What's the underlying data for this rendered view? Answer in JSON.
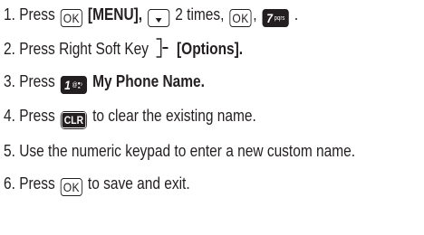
{
  "steps": [
    {
      "num": "1.",
      "press": "Press",
      "ok_key_label": "OK",
      "menu_label": "[MENU],",
      "times_text": "2 times,",
      "ok_key_label_2": "OK",
      "comma": ",",
      "key7_digit": "7",
      "key7_letters": "pqrs",
      "period": "."
    },
    {
      "num": "2.",
      "text": "Press Right Soft Key",
      "options_label": "[Options]."
    },
    {
      "num": "3.",
      "press": "Press",
      "key1_digit": "1",
      "key1_sub": "@",
      "name_label": "My Phone Name."
    },
    {
      "num": "4.",
      "press": "Press",
      "clr_label": "CLR",
      "rest": "to clear the existing name."
    },
    {
      "num": "5.",
      "text": "Use the numeric keypad to enter a new custom name."
    },
    {
      "num": "6.",
      "press": "Press",
      "ok_key_label": "OK",
      "rest": "to save and exit."
    }
  ]
}
